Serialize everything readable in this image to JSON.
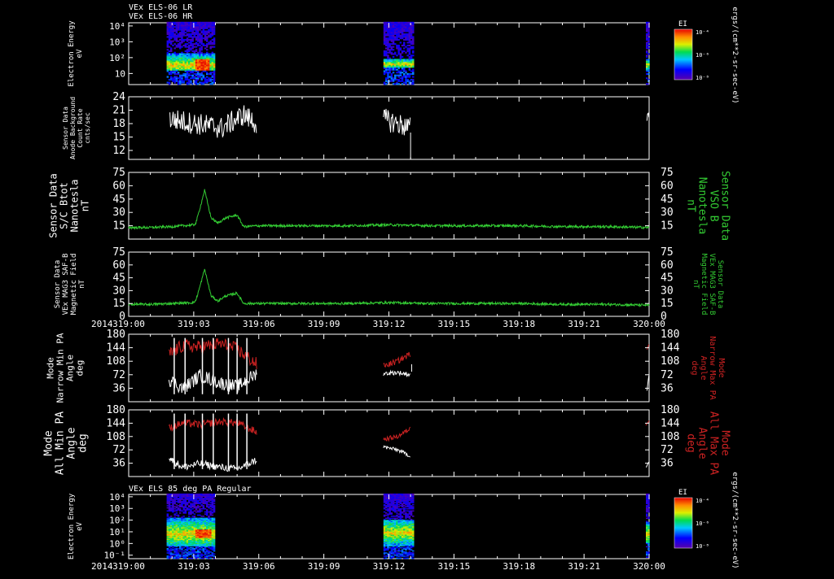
{
  "header": {
    "line1": "VEx ELS-06 LR",
    "line2": "VEx ELS-06 HR"
  },
  "footer_year": "2014",
  "time_ticks": [
    "319:00",
    "319:03",
    "319:06",
    "319:09",
    "319:12",
    "319:15",
    "319:18",
    "319:21",
    "320:00"
  ],
  "colorbar": {
    "title": "EI",
    "ticks": [
      "10⁻⁴",
      "10⁻⁶",
      "10⁻⁸"
    ],
    "unit": "ergs/(cm**2-sr-sec-eV)"
  },
  "colors": {
    "white": "#ffffff",
    "green": "#33cc33",
    "red": "#cc2222",
    "axis": "#ffffff"
  },
  "chart_data": [
    {
      "id": "spec1",
      "type": "heatmap",
      "ylabel": [
        "Electron Energy",
        "eV"
      ],
      "yticks": [
        "10⁴",
        "10³",
        "10²",
        "10"
      ],
      "ylim_log": [
        0.3,
        4.2
      ],
      "blocks": [
        {
          "x": [
            1.75,
            3.95
          ],
          "low": 1.2,
          "high": 2.2,
          "peak": 1.5,
          "hot": [
            3.0,
            3.7
          ]
        },
        {
          "x": [
            11.75,
            13.1
          ],
          "low": 1.3,
          "high": 1.9,
          "peak": 1.55,
          "hot": []
        },
        {
          "x": [
            23.85,
            24
          ],
          "low": 1.1,
          "high": 1.9,
          "peak": 1.5,
          "hot": []
        }
      ]
    },
    {
      "id": "bg",
      "type": "line",
      "ylabel": [
        "Sensor Data",
        "Anode Background",
        "Count Rate",
        "cnts/sec"
      ],
      "yticks": [
        24,
        21,
        18,
        15,
        12
      ],
      "ylim": [
        10,
        24
      ],
      "series": [
        {
          "color": "white",
          "segments": [
            {
              "x": [
                1.9,
                3.1,
                4.3,
                5.3,
                5.9
              ],
              "y": [
                19,
                18,
                17,
                20,
                18
              ],
              "noise": 2.5
            },
            {
              "x": [
                11.75,
                12.4,
                13.0
              ],
              "y": [
                19,
                18,
                17
              ],
              "noise": 2.5
            },
            {
              "x": [
                23.9,
                24
              ],
              "y": [
                19,
                20
              ],
              "noise": 1
            }
          ]
        }
      ]
    },
    {
      "id": "bvso",
      "type": "line",
      "ylabel": [
        "Sensor Data",
        "S/C Btot",
        "Nanotesla",
        "nT"
      ],
      "ylabel_right": [
        "Sensor Data",
        "VSO B",
        "Nanotesla",
        "nT"
      ],
      "yticks": [
        75,
        60,
        45,
        30,
        15
      ],
      "ylim": [
        0,
        75
      ],
      "series": [
        {
          "color": "green",
          "segments": [
            {
              "x": [
                0,
                1,
                2,
                3,
                3.1,
                3.3,
                3.5,
                3.8,
                4.1,
                4.5,
                5.0,
                5.3,
                6,
                8,
                10,
                12,
                14,
                16,
                18,
                20,
                22,
                24
              ],
              "y": [
                13,
                13,
                14,
                16,
                18,
                36,
                55,
                24,
                18,
                24,
                27,
                14,
                15,
                15,
                15,
                16,
                15,
                15,
                15,
                14,
                14,
                13
              ],
              "noise": 1.4
            }
          ]
        }
      ]
    },
    {
      "id": "bmag",
      "type": "line",
      "ylabel": [
        "Sensor Data",
        "VEx MAG3 SAF-B",
        "Magnetic Field",
        "nT"
      ],
      "ylabel_right": [
        "Sensor Data",
        "VEx MAG3 SAF-B",
        "Magnetic Field",
        "nT"
      ],
      "yticks": [
        75,
        60,
        45,
        30,
        15,
        0
      ],
      "ylim": [
        0,
        75
      ],
      "series": [
        {
          "color": "green",
          "segments": [
            {
              "x": [
                0,
                1,
                2,
                3,
                3.1,
                3.3,
                3.5,
                3.8,
                4.1,
                4.5,
                5.0,
                5.3,
                6,
                8,
                10,
                12,
                14,
                16,
                18,
                20,
                22,
                24
              ],
              "y": [
                14,
                14,
                15,
                16,
                19,
                36,
                55,
                24,
                18,
                24,
                27,
                15,
                15,
                15,
                15,
                16,
                15,
                15,
                15,
                14,
                14,
                13
              ],
              "noise": 1.4
            }
          ]
        }
      ]
    },
    {
      "id": "npa",
      "type": "line",
      "ylabel": [
        "Mode",
        "Narrow Min PA",
        "Angle",
        "deg"
      ],
      "ylabel_right": [
        "Mode",
        "Narrow Max PA",
        "Angle",
        "deg"
      ],
      "yticks": [
        180,
        144,
        108,
        72,
        36
      ],
      "ylim": [
        0,
        180
      ],
      "series": [
        {
          "color": "red",
          "segments": [
            {
              "x": [
                1.85,
                2.5,
                3.3,
                4.2,
                5.0,
                5.9
              ],
              "y": [
                125,
                150,
                145,
                155,
                140,
                100
              ],
              "noise": 18
            },
            {
              "x": [
                11.75,
                12.4,
                13.0
              ],
              "y": [
                95,
                108,
                128
              ],
              "noise": 8
            },
            {
              "x": [
                23.9,
                24
              ],
              "y": [
                140,
                155
              ],
              "noise": 2
            }
          ]
        },
        {
          "color": "white",
          "segments": [
            {
              "x": [
                1.85,
                2.5,
                3.3,
                4.2,
                5.0,
                5.9
              ],
              "y": [
                60,
                35,
                70,
                50,
                40,
                75
              ],
              "noise": 18
            },
            {
              "x": [
                11.75,
                12.4,
                13.0
              ],
              "y": [
                75,
                78,
                72
              ],
              "noise": 6
            },
            {
              "x": [
                23.9,
                24
              ],
              "y": [
                30,
                75
              ],
              "noise": 2
            }
          ]
        }
      ]
    },
    {
      "id": "apa",
      "type": "line",
      "ylabel": [
        "Mode",
        "All Min PA",
        "Angle",
        "deg"
      ],
      "ylabel_right": [
        "Mode",
        "All Max PA",
        "Angle",
        "deg"
      ],
      "yticks": [
        180,
        144,
        108,
        72,
        36
      ],
      "ylim": [
        0,
        180
      ],
      "series": [
        {
          "color": "red",
          "segments": [
            {
              "x": [
                1.85,
                2.5,
                3.3,
                4.2,
                5.0,
                5.9
              ],
              "y": [
                130,
                145,
                140,
                148,
                145,
                120
              ],
              "noise": 10
            },
            {
              "x": [
                11.75,
                12.4,
                13.0
              ],
              "y": [
                100,
                108,
                130
              ],
              "noise": 6
            },
            {
              "x": [
                23.85,
                24
              ],
              "y": [
                140,
                152
              ],
              "noise": 2
            }
          ]
        },
        {
          "color": "white",
          "segments": [
            {
              "x": [
                1.85,
                2.5,
                3.3,
                4.2,
                5.0,
                5.9
              ],
              "y": [
                50,
                25,
                35,
                25,
                20,
                45
              ],
              "noise": 10
            },
            {
              "x": [
                11.75,
                12.4,
                13.0
              ],
              "y": [
                80,
                72,
                55
              ],
              "noise": 5
            },
            {
              "x": [
                23.85,
                24
              ],
              "y": [
                25,
                40
              ],
              "noise": 2
            }
          ]
        }
      ]
    },
    {
      "id": "spec2",
      "type": "heatmap",
      "title": "VEx ELS 85 deg PA Regular",
      "ylabel": [
        "Electron Energy",
        "eV"
      ],
      "yticks": [
        "10⁴",
        "10³",
        "10²",
        "10¹",
        "10⁰",
        "10⁻¹"
      ],
      "ylim_log": [
        -1.3,
        4.2
      ],
      "blocks": [
        {
          "x": [
            1.75,
            3.95
          ],
          "low": -0.3,
          "high": 2.2,
          "peak": 0.8,
          "hot": [
            3.0,
            3.8
          ]
        },
        {
          "x": [
            11.75,
            13.1
          ],
          "low": -0.3,
          "high": 2.0,
          "peak": 0.9,
          "hot": []
        },
        {
          "x": [
            23.85,
            24
          ],
          "low": 0,
          "high": 1.8,
          "peak": 0.8,
          "hot": []
        }
      ]
    }
  ]
}
